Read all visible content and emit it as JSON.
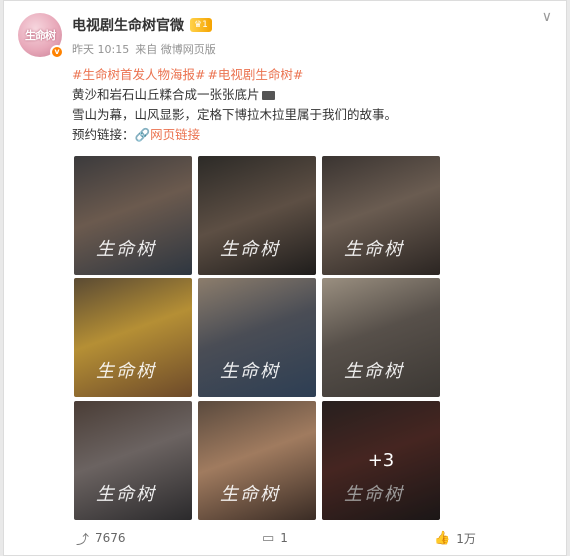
{
  "post": {
    "account_name": "电视剧生命树官微",
    "avatar_text": "生命树",
    "level": "1",
    "time": "昨天 10:15",
    "source": "来自 微博网页版",
    "hashtags": [
      "#生命树首发人物海报#",
      "#电视剧生命树#"
    ],
    "line1": "黄沙和岩石山丘糅合成一张张底片",
    "line2": "雪山为幕，山风显影，定格下博拉木拉里属于我们的故事。",
    "booking_label": "预约链接：",
    "link_icon": "link-icon",
    "link_text": "网页链接",
    "images": [
      {
        "logo": "生命树"
      },
      {
        "logo": "生命树"
      },
      {
        "logo": "生命树"
      },
      {
        "logo": "生命树"
      },
      {
        "logo": "生命树"
      },
      {
        "logo": "生命树"
      },
      {
        "logo": "生命树"
      },
      {
        "logo": "生命树"
      },
      {
        "logo": "生命树",
        "more": "+3"
      }
    ]
  },
  "actions": {
    "repost_count": "7676",
    "comment_count": "1",
    "like_count": "1万"
  },
  "colors": {
    "accent": "#eb7350",
    "badge": "#ff8200"
  }
}
